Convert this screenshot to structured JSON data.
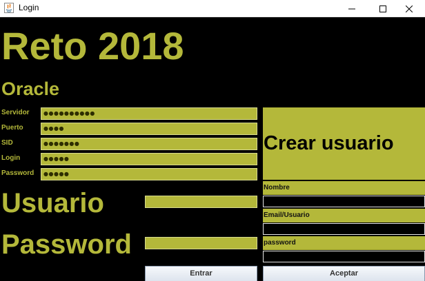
{
  "window": {
    "title": "Login"
  },
  "header": {
    "title": "Reto 2018",
    "subtitle": "Oracle"
  },
  "connection": {
    "fields": [
      {
        "label": "Servidor",
        "masked": "●●●●●●●●●●"
      },
      {
        "label": "Puerto",
        "masked": "●●●●"
      },
      {
        "label": "SID",
        "masked": "●●●●●●●"
      },
      {
        "label": "Login",
        "masked": "●●●●●"
      },
      {
        "label": "Password",
        "masked": "●●●●●"
      }
    ]
  },
  "login": {
    "user_label": "Usuario",
    "password_label": "Password",
    "enter_button": "Entrar"
  },
  "create_user": {
    "title": "Crear usuario",
    "name_label": "Nombre",
    "email_label": "Email/Usuario",
    "password_label": "password",
    "accept_button": "Aceptar"
  },
  "colors": {
    "accent": "#b4b83a",
    "background": "#000000"
  },
  "icons": [
    "java-app-icon",
    "minimize-icon",
    "maximize-icon",
    "close-icon"
  ]
}
